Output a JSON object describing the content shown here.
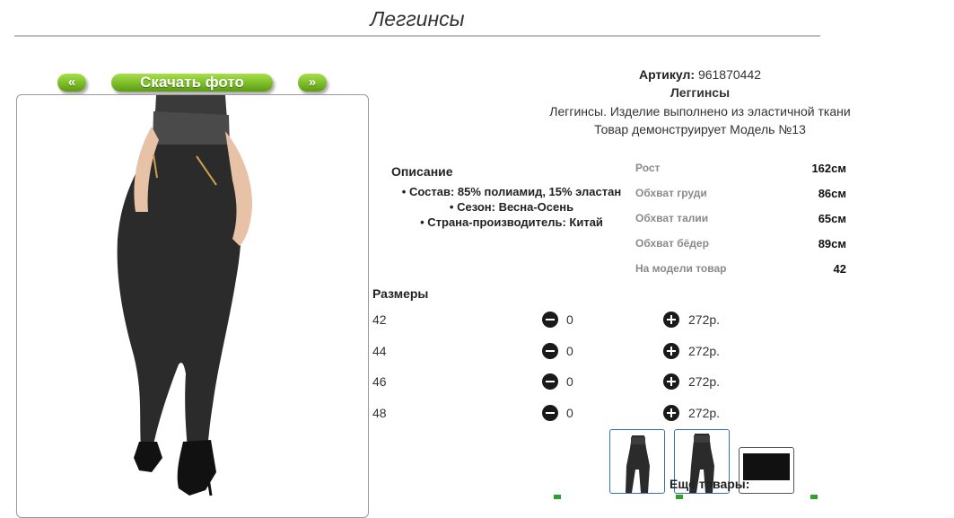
{
  "page": {
    "title": "Леггинсы"
  },
  "gallery": {
    "prev_label": "«",
    "download_label": "Скачать фото",
    "next_label": "»"
  },
  "product": {
    "article_label": "Артикул:",
    "article_value": "961870442",
    "name": "Леггинсы",
    "description": "Леггинсы. Изделие выполнено из эластичной ткани",
    "model_note": "Товар демонструирует Модель №13"
  },
  "description_section": {
    "heading": "Описание",
    "items": [
      "Состав: 85% полиамид, 15% эластан",
      "Сезон: Весна-Осень",
      "Страна-производитель: Китай"
    ]
  },
  "model_measurements": [
    {
      "label": "Рост",
      "value": "162см"
    },
    {
      "label": "Обхват груди",
      "value": "86см"
    },
    {
      "label": "Обхват талии",
      "value": "65см"
    },
    {
      "label": "Обхват бёдер",
      "value": "89см"
    },
    {
      "label": "На модели товар",
      "value": "42"
    }
  ],
  "sizes": {
    "heading": "Размеры",
    "rows": [
      {
        "size": "42",
        "qty": "0",
        "price": "272р."
      },
      {
        "size": "44",
        "qty": "0",
        "price": "272р."
      },
      {
        "size": "46",
        "qty": "0",
        "price": "272р."
      },
      {
        "size": "48",
        "qty": "0",
        "price": "272р."
      }
    ]
  },
  "more_products": {
    "label": "Ещё товары:"
  },
  "colors": {
    "accent_green": "#7fc02a",
    "thumb_border": "#3a6fb0"
  },
  "icons": {
    "minus": "minus-circle-icon",
    "plus": "plus-circle-icon"
  }
}
